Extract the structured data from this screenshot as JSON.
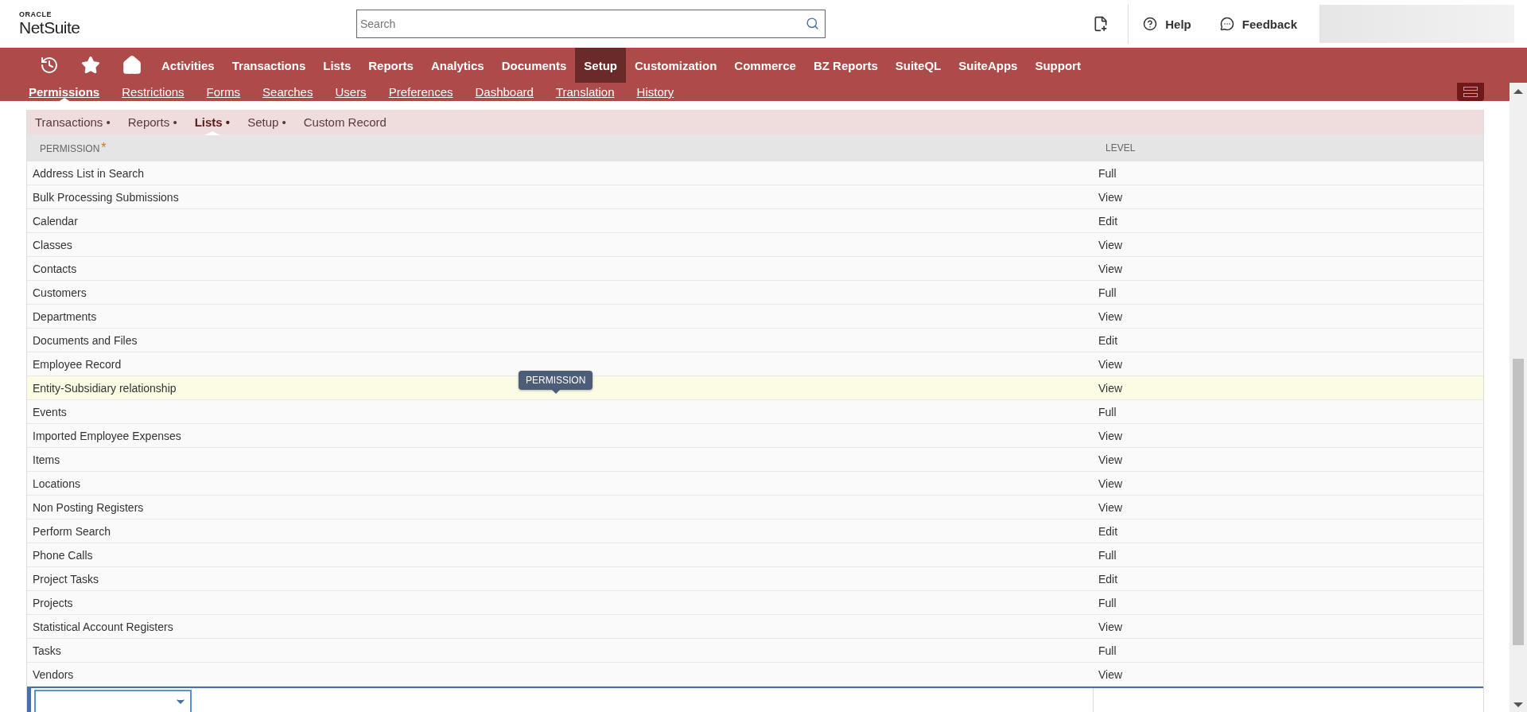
{
  "header": {
    "logo_top": "ORACLE",
    "logo_bottom": "NetSuite",
    "search": {
      "placeholder": "Search"
    },
    "help": "Help",
    "feedback": "Feedback"
  },
  "nav": [
    {
      "label": "Activities",
      "selected": false
    },
    {
      "label": "Transactions",
      "selected": false
    },
    {
      "label": "Lists",
      "selected": false
    },
    {
      "label": "Reports",
      "selected": false
    },
    {
      "label": "Analytics",
      "selected": false
    },
    {
      "label": "Documents",
      "selected": false
    },
    {
      "label": "Setup",
      "selected": true
    },
    {
      "label": "Customization",
      "selected": false
    },
    {
      "label": "Commerce",
      "selected": false
    },
    {
      "label": "BZ Reports",
      "selected": false
    },
    {
      "label": "SuiteQL",
      "selected": false
    },
    {
      "label": "SuiteApps",
      "selected": false
    },
    {
      "label": "Support",
      "selected": false
    }
  ],
  "subtabs": [
    {
      "label": "Permissions",
      "selected": true
    },
    {
      "label": "Restrictions",
      "selected": false
    },
    {
      "label": "Forms",
      "selected": false
    },
    {
      "label": "Searches",
      "selected": false
    },
    {
      "label": "Users",
      "selected": false
    },
    {
      "label": "Preferences",
      "selected": false
    },
    {
      "label": "Dashboard",
      "selected": false
    },
    {
      "label": "Translation",
      "selected": false
    },
    {
      "label": "History",
      "selected": false
    }
  ],
  "permission_tabs": [
    {
      "label": "Transactions •",
      "selected": false
    },
    {
      "label": "Reports •",
      "selected": false
    },
    {
      "label": "Lists •",
      "selected": true
    },
    {
      "label": "Setup •",
      "selected": false
    },
    {
      "label": "Custom Record",
      "selected": false
    }
  ],
  "table": {
    "columns": [
      {
        "label": "PERMISSION",
        "required_mark": "*"
      },
      {
        "label": "LEVEL"
      }
    ],
    "rows": [
      {
        "permission": "Address List in Search",
        "level": "Full",
        "selected": false
      },
      {
        "permission": "Bulk Processing Submissions",
        "level": "View",
        "selected": false
      },
      {
        "permission": "Calendar",
        "level": "Edit",
        "selected": false
      },
      {
        "permission": "Classes",
        "level": "View",
        "selected": false
      },
      {
        "permission": "Contacts",
        "level": "View",
        "selected": false
      },
      {
        "permission": "Customers",
        "level": "Full",
        "selected": false
      },
      {
        "permission": "Departments",
        "level": "View",
        "selected": false
      },
      {
        "permission": "Documents and Files",
        "level": "Edit",
        "selected": false
      },
      {
        "permission": "Employee Record",
        "level": "View",
        "selected": false
      },
      {
        "permission": "Entity-Subsidiary relationship",
        "level": "View",
        "selected": true,
        "tooltip": "PERMISSION"
      },
      {
        "permission": "Events",
        "level": "Full",
        "selected": false
      },
      {
        "permission": "Imported Employee Expenses",
        "level": "View",
        "selected": false
      },
      {
        "permission": "Items",
        "level": "View",
        "selected": false
      },
      {
        "permission": "Locations",
        "level": "View",
        "selected": false
      },
      {
        "permission": "Non Posting Registers",
        "level": "View",
        "selected": false
      },
      {
        "permission": "Perform Search",
        "level": "Edit",
        "selected": false
      },
      {
        "permission": "Phone Calls",
        "level": "Full",
        "selected": false
      },
      {
        "permission": "Project Tasks",
        "level": "Edit",
        "selected": false
      },
      {
        "permission": "Projects",
        "level": "Full",
        "selected": false
      },
      {
        "permission": "Statistical Account Registers",
        "level": "View",
        "selected": false
      },
      {
        "permission": "Tasks",
        "level": "Full",
        "selected": false
      },
      {
        "permission": "Vendors",
        "level": "View",
        "selected": false
      }
    ]
  }
}
